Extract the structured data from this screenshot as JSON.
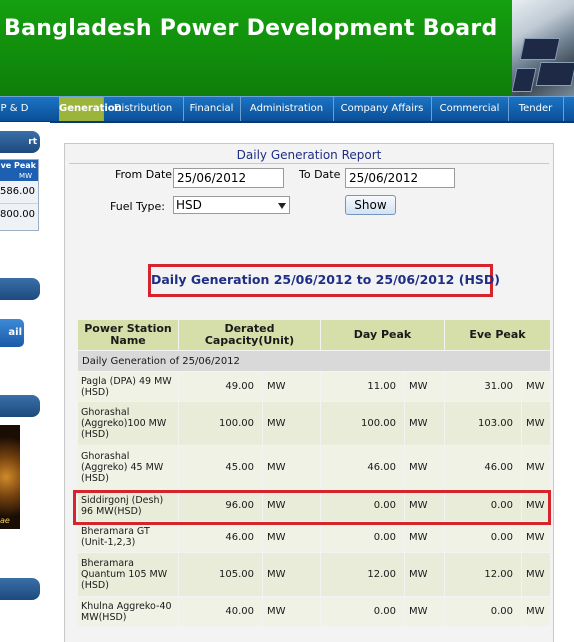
{
  "header": {
    "title": "Bangladesh Power Development Board"
  },
  "nav": {
    "items": [
      {
        "label": "P & D"
      },
      {
        "label": "Generation"
      },
      {
        "label": "Distribution"
      },
      {
        "label": "Financial"
      },
      {
        "label": "Administration"
      },
      {
        "label": "Company Affairs"
      },
      {
        "label": "Commercial"
      },
      {
        "label": "Tender"
      }
    ],
    "active": "Generation"
  },
  "sidebar": {
    "head1": "rt",
    "peak_label": "ve Peak",
    "peak_unit": "MW",
    "val1": "586.00",
    "val2": "800.00",
    "mail_label": "ail",
    "caption": "ae"
  },
  "report": {
    "title": "Daily Generation Report",
    "from_label": "From Date",
    "from_value": "25/06/2012",
    "to_label": "To Date",
    "to_value": "25/06/2012",
    "fuel_label": "Fuel Type:",
    "fuel_value": "HSD",
    "show_label": "Show",
    "heading": "Daily Generation 25/06/2012 to 25/06/2012 (HSD)"
  },
  "table": {
    "headers": {
      "name": "Power Station Name",
      "derated": "Derated Capacity(Unit)",
      "day_peak": "Day Peak",
      "eve_peak": "Eve Peak"
    },
    "group_label": "Daily Generation of 25/06/2012",
    "rows": [
      {
        "name": "Pagla (DPA) 49 MW (HSD)",
        "derated": "49.00",
        "day": "11.00",
        "eve": "31.00",
        "unit": "MW"
      },
      {
        "name": "Ghorashal (Aggreko)100 MW (HSD)",
        "derated": "100.00",
        "day": "100.00",
        "eve": "103.00",
        "unit": "MW"
      },
      {
        "name": "Ghorashal (Aggreko) 45 MW (HSD)",
        "derated": "45.00",
        "day": "46.00",
        "eve": "46.00",
        "unit": "MW"
      },
      {
        "name": "Siddirgonj (Desh) 96 MW(HSD)",
        "derated": "96.00",
        "day": "0.00",
        "eve": "0.00",
        "unit": "MW"
      },
      {
        "name": "Bheramara GT (Unit-1,2,3)",
        "derated": "46.00",
        "day": "0.00",
        "eve": "0.00",
        "unit": "MW"
      },
      {
        "name": "Bheramara Quantum 105 MW (HSD)",
        "derated": "105.00",
        "day": "12.00",
        "eve": "12.00",
        "unit": "MW"
      },
      {
        "name": "Khulna Aggreko-40 MW(HSD)",
        "derated": "40.00",
        "day": "0.00",
        "eve": "0.00",
        "unit": "MW"
      }
    ]
  }
}
